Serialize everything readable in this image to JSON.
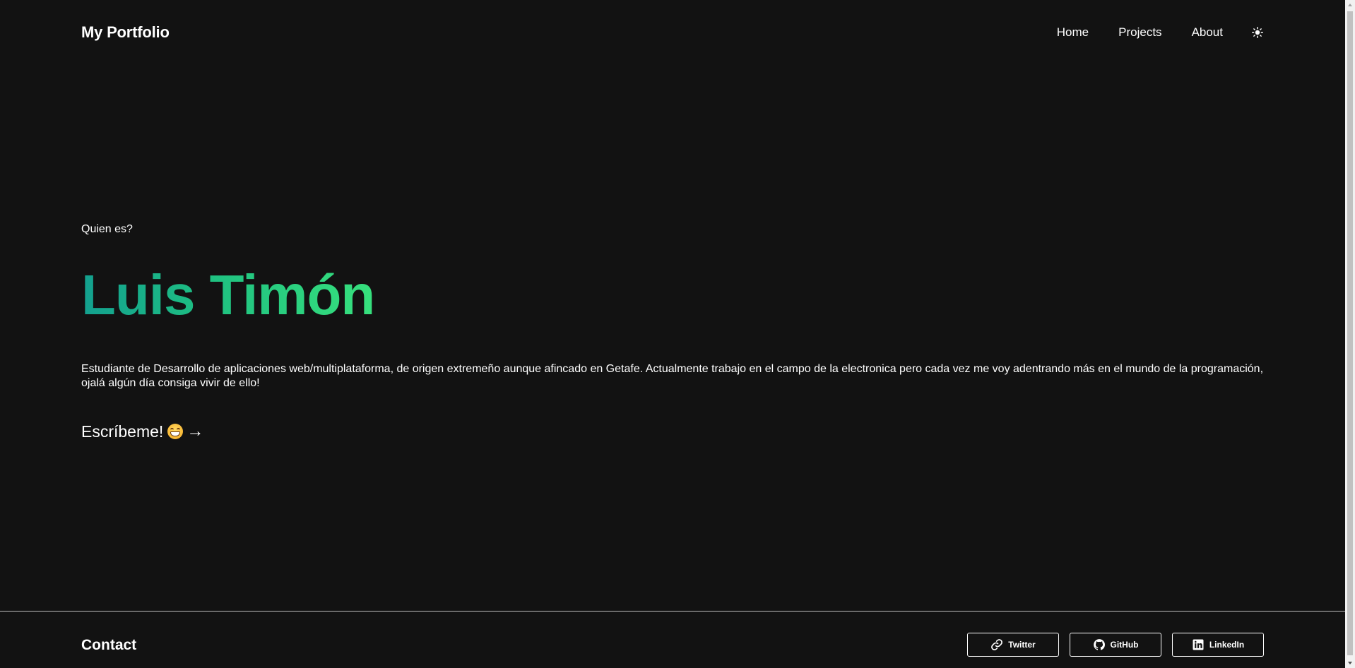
{
  "header": {
    "brand": "My Portfolio",
    "nav": {
      "home": "Home",
      "projects": "Projects",
      "about": "About"
    },
    "theme_icon": "sun-icon"
  },
  "hero": {
    "eyebrow": "Quien es?",
    "name": "Luis Timón",
    "name_gradient": [
      "#13a08f",
      "#37e07d"
    ],
    "bio": "Estudiante de Desarrollo de aplicaciones web/multiplataforma, de origen extremeño aunque afincado en Getafe. Actualmente trabajo en el campo de la electronica pero cada vez me voy adentrando más en el mundo de la programación, ojalá algún día consiga vivir de ello!",
    "cta_label": "Escríbeme!",
    "cta_arrow": "→"
  },
  "footer": {
    "title": "Contact",
    "socials": [
      {
        "label": "Twitter",
        "icon": "link-icon"
      },
      {
        "label": "GitHub",
        "icon": "github-icon"
      },
      {
        "label": "LinkedIn",
        "icon": "linkedin-icon"
      }
    ]
  },
  "colors": {
    "background": "#121212",
    "text": "#ffffff",
    "divider": "#bdbdbd"
  }
}
